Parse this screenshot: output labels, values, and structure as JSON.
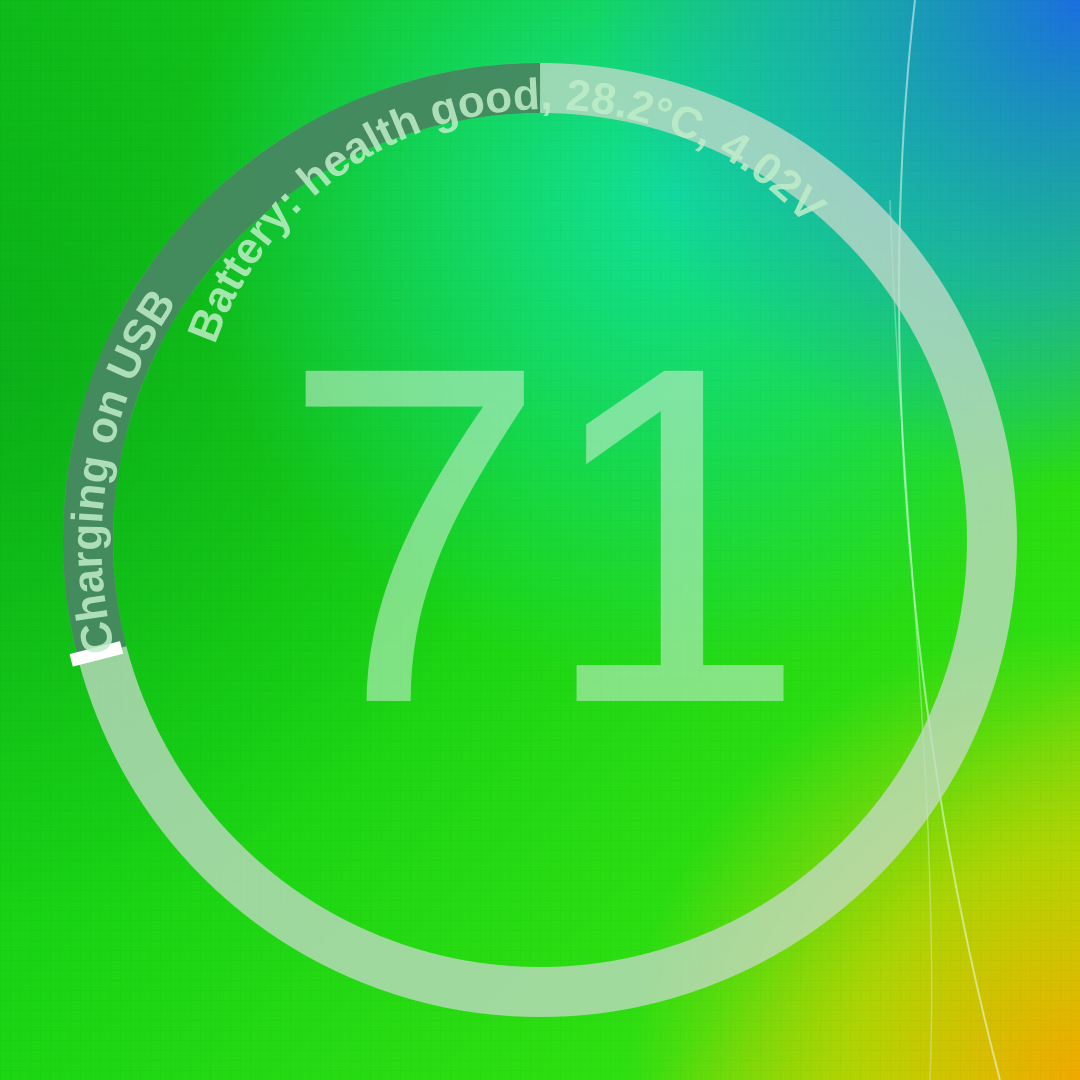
{
  "battery_widget": {
    "level": 71,
    "level_text": "71",
    "status_text": "Charging on USB",
    "details_text": "Battery: health good, 28.2°C, 4.02V",
    "charge_fraction": 0.71,
    "colors": {
      "ring_track": "#c8d8cc",
      "ring_progress": "#2f7a4e",
      "marker": "#ffffff",
      "text": "#bfecc8"
    }
  }
}
